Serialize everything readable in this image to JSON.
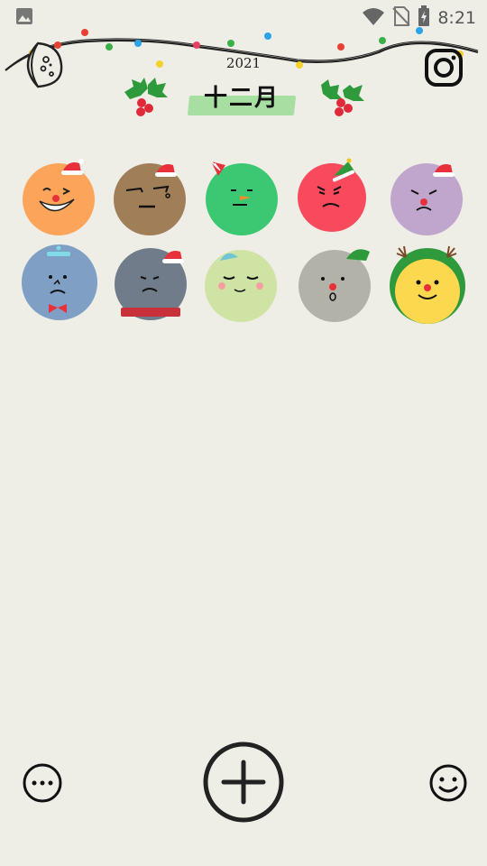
{
  "status_bar": {
    "time": "8:21",
    "icons": [
      "image-icon",
      "wifi-icon",
      "no-sim-icon",
      "battery-icon"
    ]
  },
  "header": {
    "year": "2021",
    "month": "十二月",
    "left_icon": "moon-face-icon",
    "right_icon": "camera-icon"
  },
  "colors": {
    "background": "#eeeee6",
    "month_highlight": "#9fdc9a"
  },
  "moods": [
    {
      "name": "orange-laughing-santa-hat",
      "color": "#fca55a"
    },
    {
      "name": "brown-blank-santa-hat",
      "color": "#a07e58"
    },
    {
      "name": "green-carrot-party-hat",
      "color": "#3cc873"
    },
    {
      "name": "red-angry-tree-hat",
      "color": "#f84a5c"
    },
    {
      "name": "purple-sad-santa-hat",
      "color": "#c0a5cc"
    },
    {
      "name": "blue-frowning-bowtie",
      "color": "#7f9fc4"
    },
    {
      "name": "gray-sad-scarf-santa-hat",
      "color": "#707c8a"
    },
    {
      "name": "lightgreen-sleepy-beanie",
      "color": "#cfe3a5"
    },
    {
      "name": "gray-surprised-elf-hat",
      "color": "#b2b2a8"
    },
    {
      "name": "yellow-happy-reindeer-hood",
      "color": "#fcd84e"
    }
  ],
  "bottom_bar": {
    "left_icon": "more-icon",
    "center_icon": "add-icon",
    "right_icon": "smiley-icon"
  }
}
